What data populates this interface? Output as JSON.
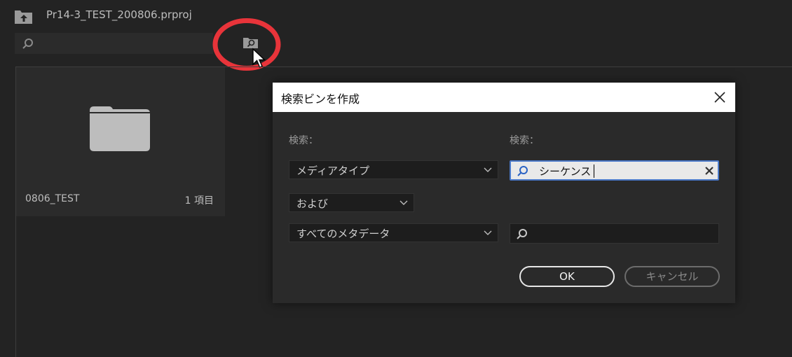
{
  "project": {
    "title": "Pr14-3_TEST_200806.prproj",
    "up_icon": "folder-up-icon",
    "search_icon": "search-icon",
    "new_search_bin_icon": "search-bin-icon"
  },
  "bin": {
    "name": "0806_TEST",
    "count": "1 項目",
    "icon": "folder-icon"
  },
  "dialog": {
    "title": "検索ビンを作成",
    "close_icon": "close-icon",
    "label_search_left": "検索：",
    "label_search_right": "検索：",
    "dropdown_type": "メディアタイプ",
    "dropdown_operator": "および",
    "dropdown_metadata": "すべてのメタデータ",
    "input_1_value": "シーケンス",
    "input_2_value": "",
    "ok_label": "OK",
    "cancel_label": "キャンセル"
  },
  "colors": {
    "background": "#232323",
    "highlight_circle": "#e8343a",
    "input_focus_border": "#4a79c9"
  }
}
